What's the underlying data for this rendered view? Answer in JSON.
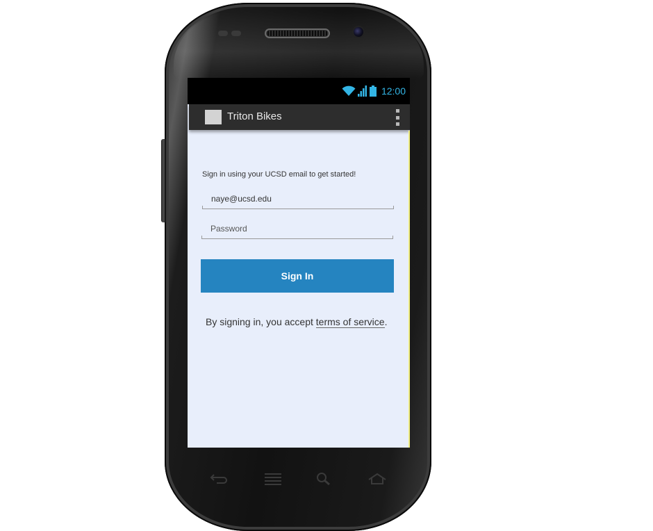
{
  "status_bar": {
    "time": "12:00",
    "icons": [
      "wifi-icon",
      "signal-icon",
      "battery-icon"
    ],
    "accent_color": "#33b5e5"
  },
  "action_bar": {
    "title": "Triton Bikes",
    "app_icon": "app-placeholder-icon",
    "menu_icon": "overflow-menu-icon"
  },
  "login": {
    "helper_text": "Sign in using your UCSD email to get started!",
    "email_value": "naye@ucsd.edu",
    "password_placeholder": "Password",
    "sign_in_label": "Sign In",
    "button_color": "#2584c0",
    "terms_prefix": "By signing in, you accept ",
    "terms_link": "terms of service",
    "terms_suffix": "."
  },
  "nav_bar": {
    "buttons": [
      "back-icon",
      "menu-icon",
      "search-icon",
      "home-icon"
    ]
  }
}
